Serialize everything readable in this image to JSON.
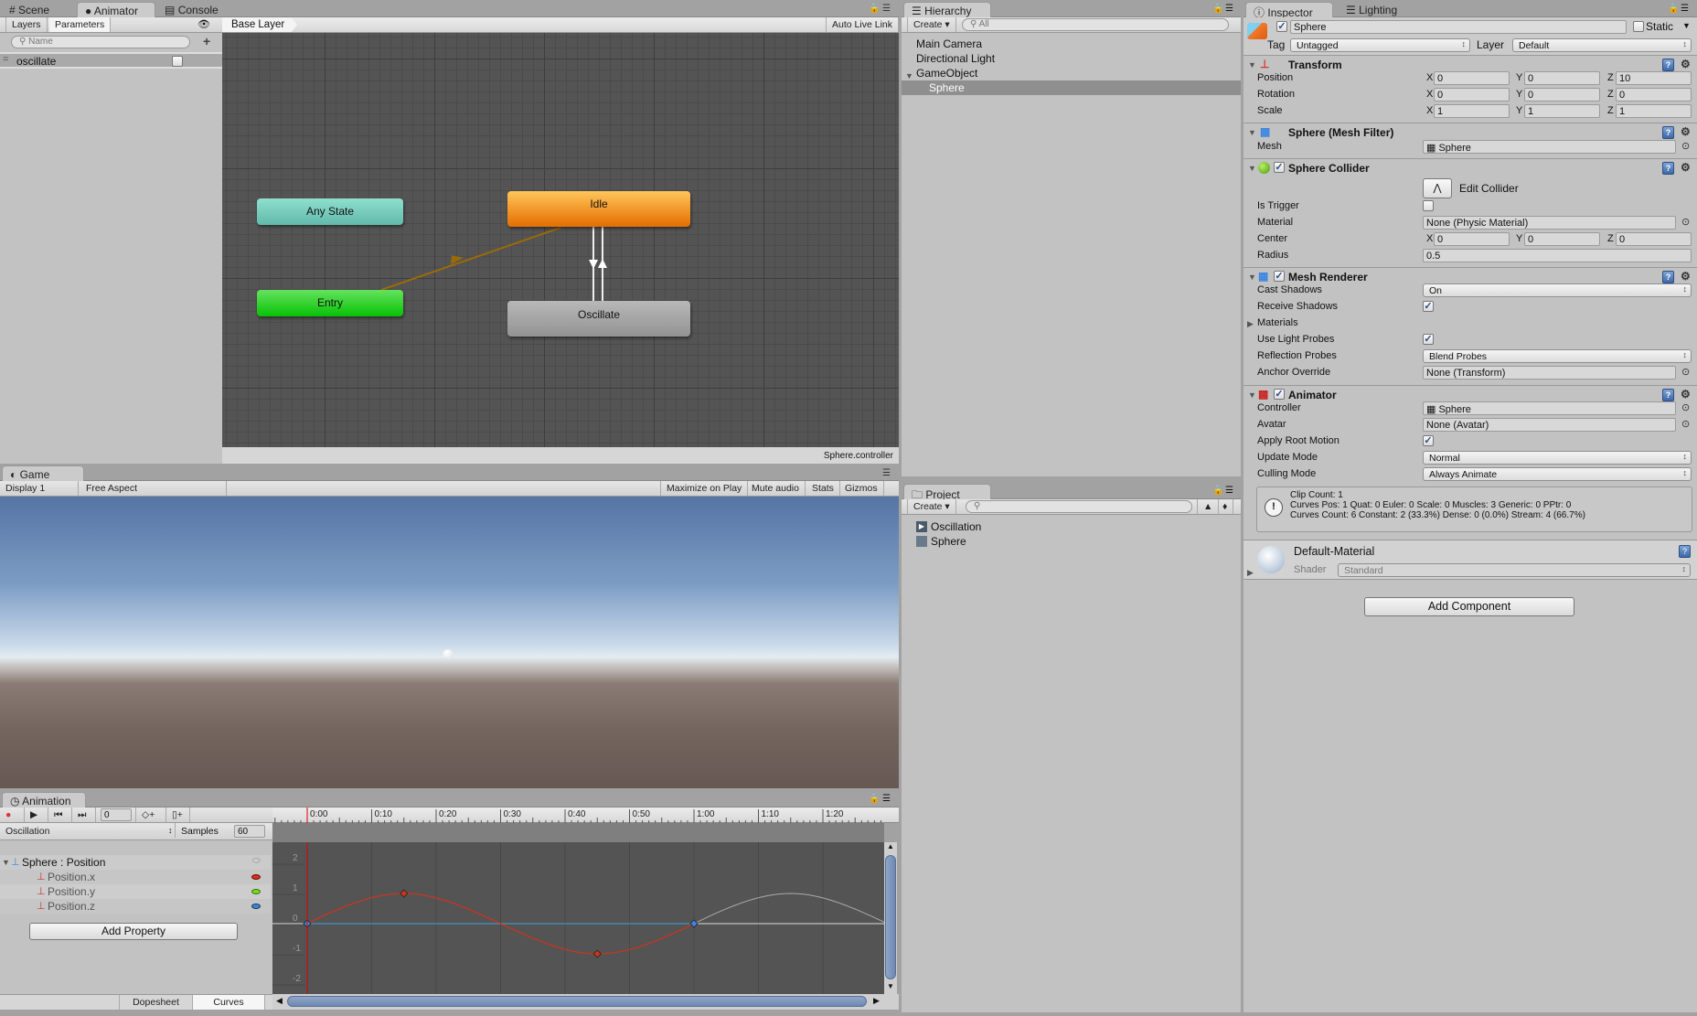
{
  "colors": {
    "accent_selection": "#8f8f8f",
    "any_state": "#6cc4b4",
    "entry": "#19c419",
    "idle": "#f08a0e",
    "oscillate": "#a6a6a6",
    "curve_x": "#d0331c",
    "curve_y": "#7bd52a",
    "curve_z": "#3a86e0",
    "playhead": "#e00000"
  },
  "top_tabs": {
    "scene": "Scene",
    "animator": "Animator",
    "console": "Console"
  },
  "animator": {
    "tabs": {
      "layers": "Layers",
      "parameters": "Parameters"
    },
    "search_placeholder": "Name",
    "parameters": [
      {
        "name": "oscillate",
        "type": "bool",
        "value": false
      }
    ],
    "breadcrumb": "Base Layer",
    "auto_live_link": "Auto Live Link",
    "states": {
      "any": "Any State",
      "entry": "Entry",
      "idle": "Idle",
      "oscillate": "Oscillate"
    },
    "controller_file": "Sphere.controller"
  },
  "game": {
    "tab": "Game",
    "display": "Display 1",
    "aspect": "Free Aspect",
    "maximize": "Maximize on Play",
    "mute": "Mute audio",
    "stats": "Stats",
    "gizmos": "Gizmos"
  },
  "animation": {
    "tab": "Animation",
    "frame": "0",
    "clip": "Oscillation",
    "samples_label": "Samples",
    "samples": "60",
    "group": "Sphere : Position",
    "properties": [
      {
        "name": "Position.x",
        "color": "#d0331c"
      },
      {
        "name": "Position.y",
        "color": "#7bd52a"
      },
      {
        "name": "Position.z",
        "color": "#3a86e0"
      }
    ],
    "add_property": "Add Property",
    "bottom_tabs": {
      "dopesheet": "Dopesheet",
      "curves": "Curves"
    },
    "ruler_labels": [
      "0:00",
      "0:10",
      "0:20",
      "0:30",
      "0:40",
      "0:50",
      "1:00",
      "1:10",
      "1:20"
    ],
    "value_labels": [
      "2",
      "1",
      "0",
      "-1",
      "-2"
    ],
    "curves": {
      "position_x": {
        "frames": [
          0,
          15,
          45,
          60
        ],
        "values": [
          0,
          1,
          -1,
          0
        ]
      },
      "position_y": {
        "frames": [
          0,
          60
        ],
        "values": [
          0,
          0
        ]
      },
      "position_z": {
        "frames": [
          0,
          60
        ],
        "values": [
          0,
          0
        ]
      }
    }
  },
  "hierarchy": {
    "tab": "Hierarchy",
    "create": "Create",
    "search_placeholder": "All",
    "items": [
      {
        "name": "Main Camera",
        "depth": 0
      },
      {
        "name": "Directional Light",
        "depth": 0
      },
      {
        "name": "GameObject",
        "depth": 0,
        "expanded": true
      },
      {
        "name": "Sphere",
        "depth": 1,
        "selected": true
      }
    ]
  },
  "project": {
    "tab": "Project",
    "create": "Create",
    "items": [
      {
        "name": "Oscillation",
        "icon": "animation-clip-icon"
      },
      {
        "name": "Sphere",
        "icon": "animator-controller-icon"
      }
    ]
  },
  "inspector": {
    "tabs": {
      "inspector": "Inspector",
      "lighting": "Lighting"
    },
    "object_name": "Sphere",
    "active": true,
    "static_label": "Static",
    "static": false,
    "tag_label": "Tag",
    "tag": "Untagged",
    "layer_label": "Layer",
    "layer": "Default",
    "transform": {
      "title": "Transform",
      "position_label": "Position",
      "rotation_label": "Rotation",
      "scale_label": "Scale",
      "position": [
        "0",
        "0",
        "10"
      ],
      "rotation": [
        "0",
        "0",
        "0"
      ],
      "scale": [
        "1",
        "1",
        "1"
      ]
    },
    "axes": [
      "X",
      "Y",
      "Z"
    ],
    "mesh_filter": {
      "title": "Sphere (Mesh Filter)",
      "mesh_label": "Mesh",
      "mesh": "Sphere"
    },
    "collider": {
      "title": "Sphere Collider",
      "enabled": true,
      "edit_collider": "Edit Collider",
      "is_trigger_label": "Is Trigger",
      "is_trigger": false,
      "material_label": "Material",
      "material": "None (Physic Material)",
      "center_label": "Center",
      "center": [
        "0",
        "0",
        "0"
      ],
      "radius_label": "Radius",
      "radius": "0.5"
    },
    "renderer": {
      "title": "Mesh Renderer",
      "enabled": true,
      "cast_shadows_label": "Cast Shadows",
      "cast_shadows": "On",
      "receive_shadows_label": "Receive Shadows",
      "receive_shadows": true,
      "materials_label": "Materials",
      "light_probes_label": "Use Light Probes",
      "light_probes": true,
      "reflection_label": "Reflection Probes",
      "reflection": "Blend Probes",
      "anchor_label": "Anchor Override",
      "anchor": "None (Transform)"
    },
    "animator": {
      "title": "Animator",
      "enabled": true,
      "controller_label": "Controller",
      "controller": "Sphere",
      "avatar_label": "Avatar",
      "avatar": "None (Avatar)",
      "root_motion_label": "Apply Root Motion",
      "root_motion": true,
      "update_label": "Update Mode",
      "update": "Normal",
      "culling_label": "Culling Mode",
      "culling": "Always Animate",
      "info": [
        "Clip Count: 1",
        "Curves Pos: 1 Quat: 0 Euler: 0 Scale: 0 Muscles: 3 Generic: 0 PPtr: 0",
        "Curves Count: 6 Constant: 2 (33.3%) Dense: 0 (0.0%) Stream: 4 (66.7%)"
      ]
    },
    "material": {
      "name": "Default-Material",
      "shader_label": "Shader",
      "shader": "Standard"
    },
    "add_component": "Add Component"
  }
}
